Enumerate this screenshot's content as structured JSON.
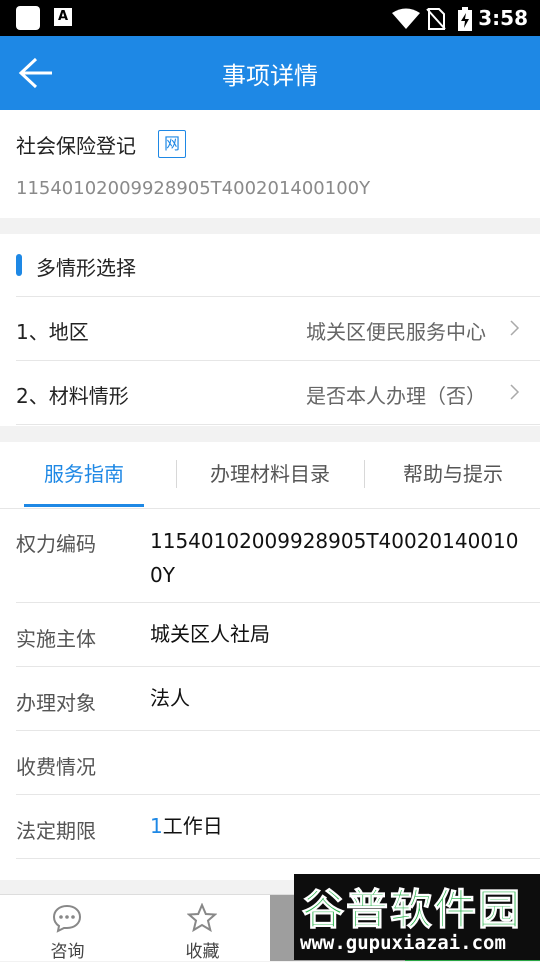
{
  "status_bar": {
    "time": "3:58",
    "notification_letter": "A"
  },
  "app_bar": {
    "title": "事项详情"
  },
  "item": {
    "name": "社会保险登记",
    "badge": "网",
    "code": "11540102009928905T400201400100Y"
  },
  "situation": {
    "title": "多情形选择",
    "rows": [
      {
        "label": "1、地区",
        "value": "城关区便民服务中心"
      },
      {
        "label": "2、材料情形",
        "value": "是否本人办理（否）"
      }
    ]
  },
  "tabs": [
    "服务指南",
    "办理材料目录",
    "帮助与提示"
  ],
  "active_tab": 0,
  "details": [
    {
      "key": "权力编码",
      "value": "11540102009928905T400201400100Y"
    },
    {
      "key": "实施主体",
      "value": "城关区人社局"
    },
    {
      "key": "办理对象",
      "value": "法人"
    },
    {
      "key": "收费情况",
      "value": ""
    },
    {
      "key": "法定期限",
      "value_num": "1",
      "value_unit": "工作日"
    }
  ],
  "bottom_nav": [
    {
      "label": "咨询",
      "icon": "chat-icon"
    },
    {
      "label": "收藏",
      "icon": "star-icon"
    }
  ],
  "watermark": {
    "brand": "谷普软件园",
    "url": "www.gupuxiazai.com"
  },
  "colors": {
    "primary": "#1e88e5",
    "accent_green": "#28a745"
  }
}
